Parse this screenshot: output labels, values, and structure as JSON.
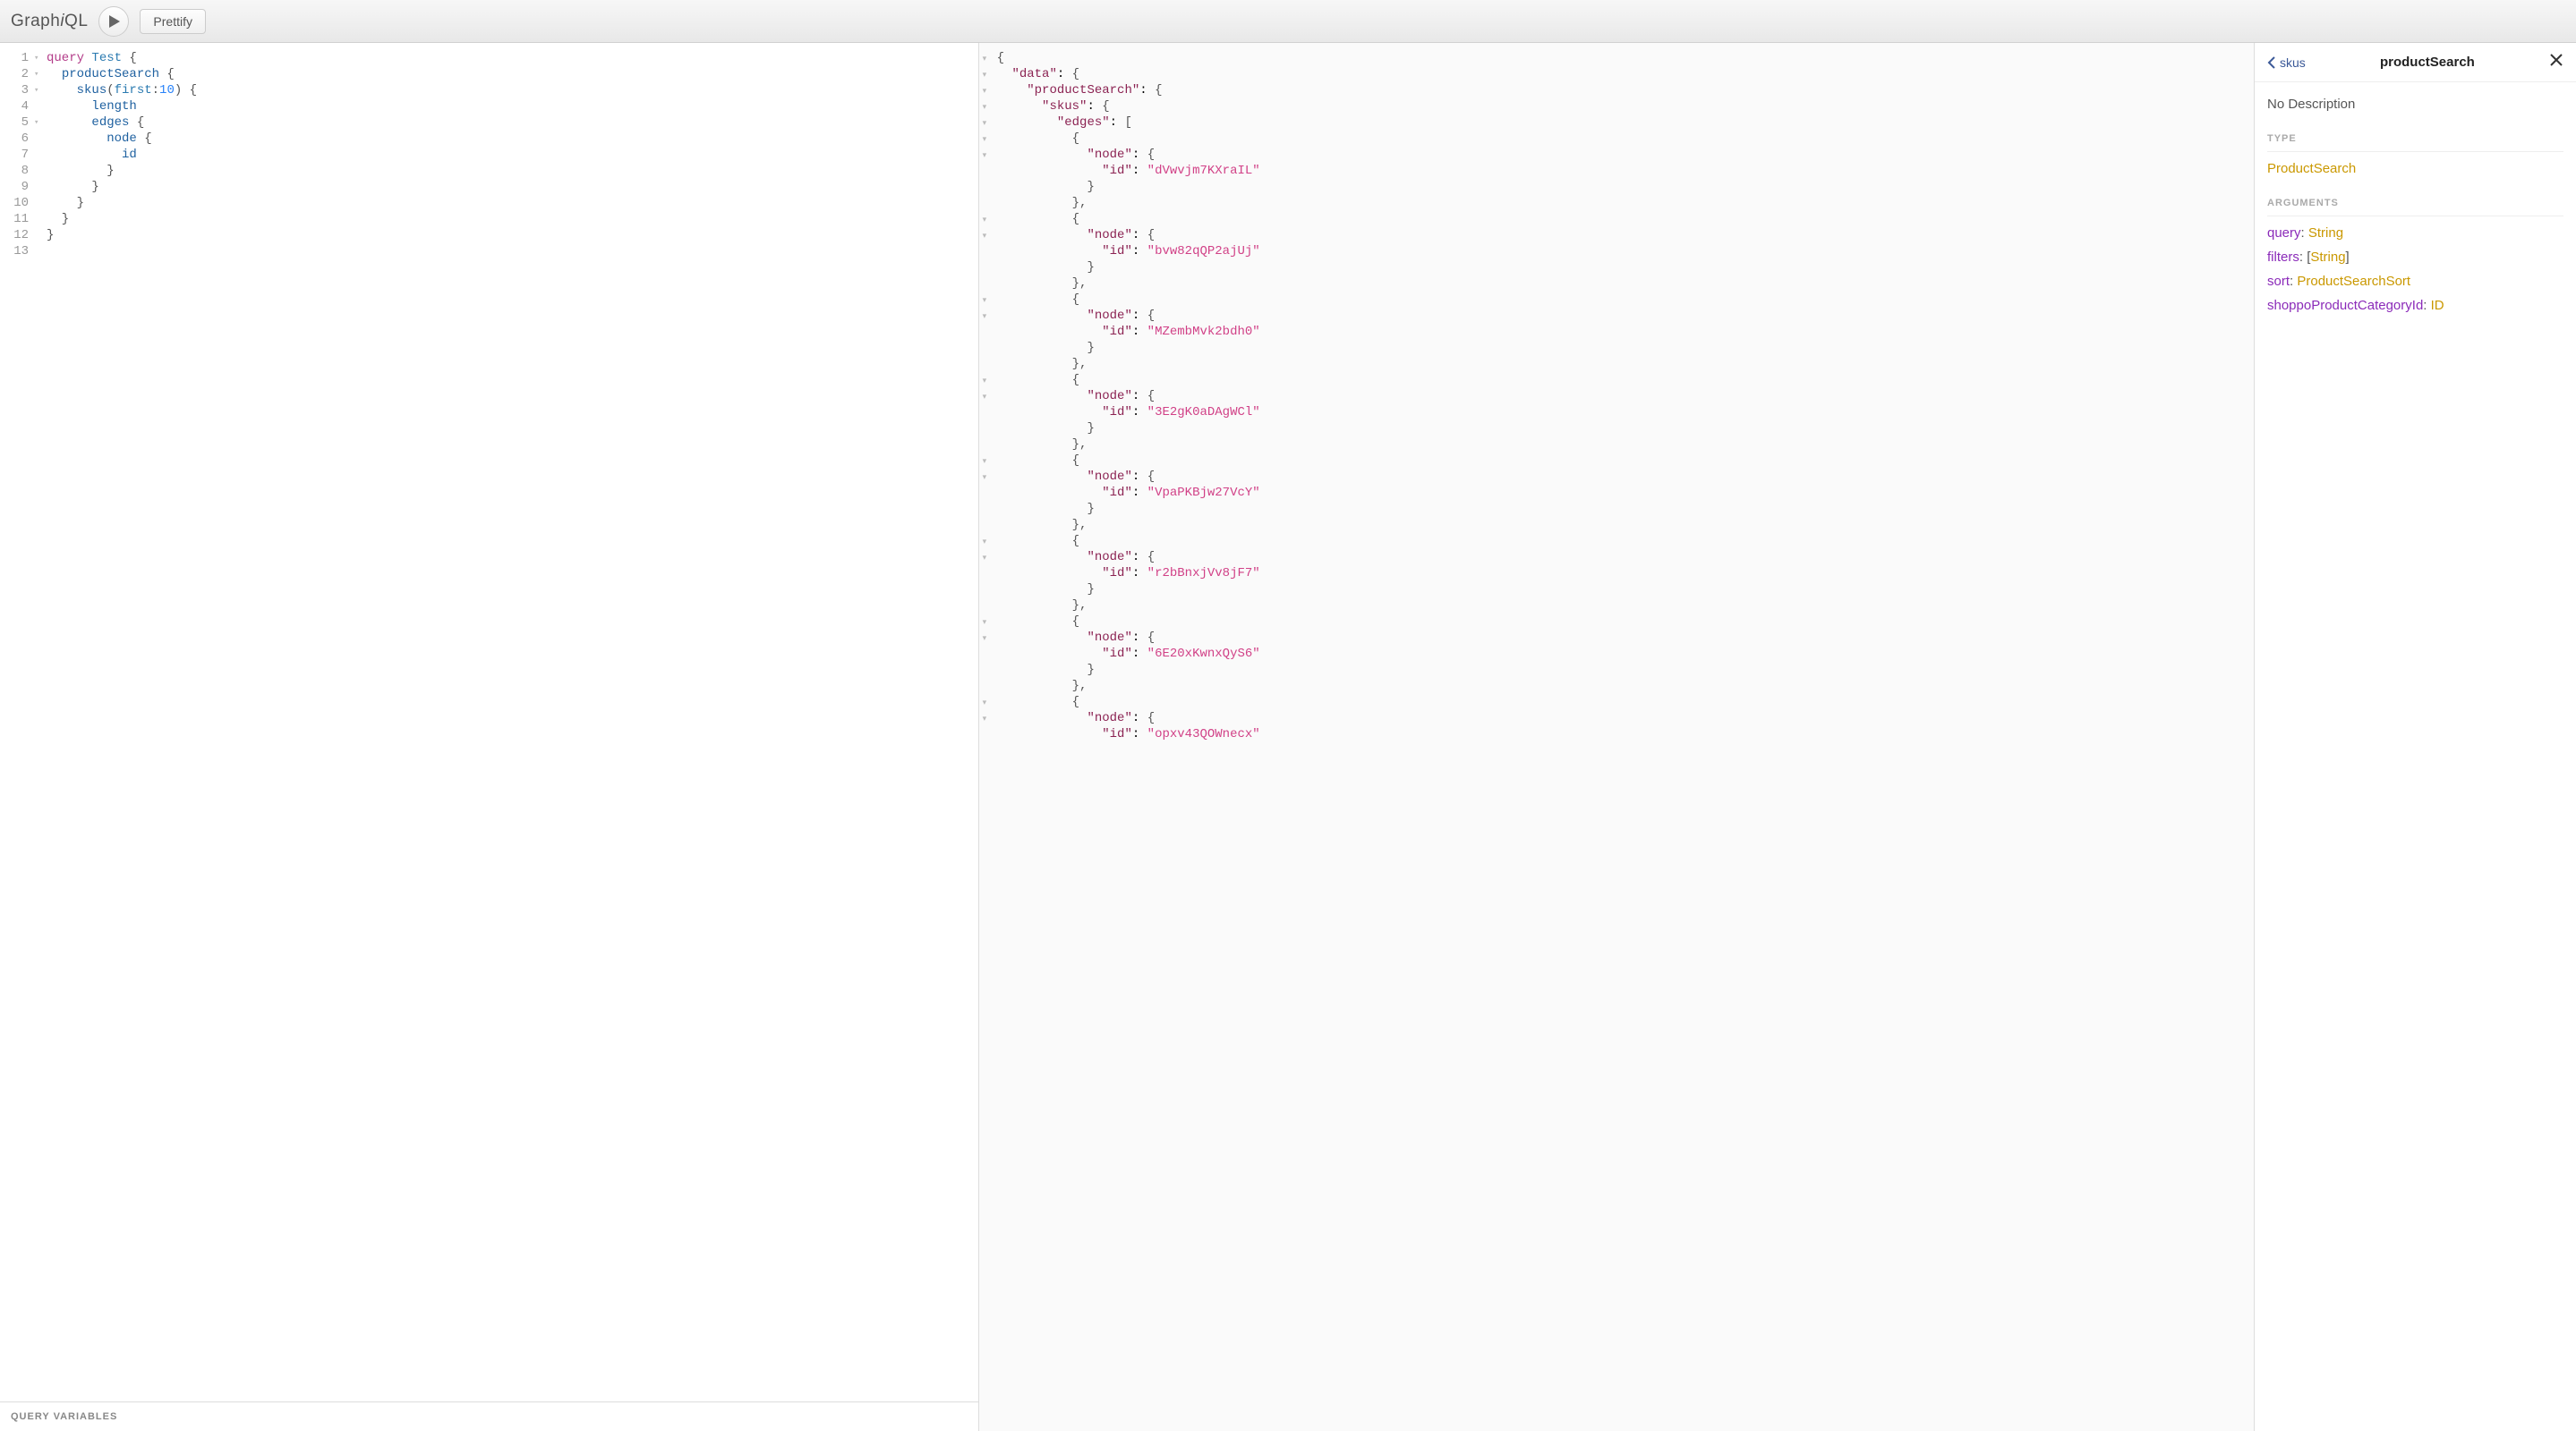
{
  "toolbar": {
    "logo_prefix": "Graph",
    "logo_i": "i",
    "logo_suffix": "QL",
    "prettify_label": "Prettify"
  },
  "editor": {
    "lines": [
      {
        "n": "1",
        "fold": "▾",
        "tokens": [
          {
            "t": "query ",
            "c": "kw"
          },
          {
            "t": "Test",
            "c": "def"
          },
          {
            "t": " {",
            "c": "brace"
          }
        ]
      },
      {
        "n": "2",
        "fold": "▾",
        "tokens": [
          {
            "t": "  ",
            "c": ""
          },
          {
            "t": "productSearch",
            "c": "prop"
          },
          {
            "t": " {",
            "c": "brace"
          }
        ]
      },
      {
        "n": "3",
        "fold": "▾",
        "tokens": [
          {
            "t": "    ",
            "c": ""
          },
          {
            "t": "skus",
            "c": "prop"
          },
          {
            "t": "(",
            "c": "punc"
          },
          {
            "t": "first",
            "c": "attr"
          },
          {
            "t": ":",
            "c": "punc"
          },
          {
            "t": "10",
            "c": "num"
          },
          {
            "t": ")",
            "c": "punc"
          },
          {
            "t": " {",
            "c": "brace"
          }
        ]
      },
      {
        "n": "4",
        "fold": "",
        "tokens": [
          {
            "t": "      ",
            "c": ""
          },
          {
            "t": "length",
            "c": "prop"
          }
        ]
      },
      {
        "n": "5",
        "fold": "▾",
        "tokens": [
          {
            "t": "      ",
            "c": ""
          },
          {
            "t": "edges",
            "c": "prop"
          },
          {
            "t": " {",
            "c": "brace"
          }
        ]
      },
      {
        "n": "6",
        "fold": "",
        "tokens": [
          {
            "t": "        ",
            "c": ""
          },
          {
            "t": "node",
            "c": "prop"
          },
          {
            "t": " {",
            "c": "brace"
          }
        ]
      },
      {
        "n": "7",
        "fold": "",
        "tokens": [
          {
            "t": "          ",
            "c": ""
          },
          {
            "t": "id",
            "c": "prop"
          }
        ]
      },
      {
        "n": "8",
        "fold": "",
        "tokens": [
          {
            "t": "        }",
            "c": "brace"
          }
        ]
      },
      {
        "n": "9",
        "fold": "",
        "tokens": [
          {
            "t": "      }",
            "c": "brace"
          }
        ]
      },
      {
        "n": "10",
        "fold": "",
        "tokens": [
          {
            "t": "    }",
            "c": "brace"
          }
        ]
      },
      {
        "n": "11",
        "fold": "",
        "tokens": [
          {
            "t": "  }",
            "c": "brace"
          }
        ]
      },
      {
        "n": "12",
        "fold": "",
        "tokens": [
          {
            "t": "}",
            "c": "brace"
          }
        ]
      },
      {
        "n": "13",
        "fold": "",
        "tokens": []
      }
    ],
    "query_variables_label": "Query Variables"
  },
  "result": {
    "ids": [
      "dVwvjm7KXraIL",
      "bvw82qQP2ajUj",
      "MZembMvk2bdh0",
      "3E2gK0aDAgWCl",
      "VpaPKBjw27VcY",
      "r2bBnxjVv8jF7",
      "6E20xKwnxQyS6",
      "opxv43QOWnecx"
    ]
  },
  "docs": {
    "back_label": "skus",
    "title": "productSearch",
    "description": "No Description",
    "type_section": "TYPE",
    "type_link": "ProductSearch",
    "args_section": "ARGUMENTS",
    "args": [
      {
        "name": "query",
        "type": "String",
        "bracket": false
      },
      {
        "name": "filters",
        "type": "String",
        "bracket": true
      },
      {
        "name": "sort",
        "type": "ProductSearchSort",
        "bracket": false
      },
      {
        "name": "shoppoProductCategoryId",
        "type": "ID",
        "bracket": false
      }
    ]
  }
}
